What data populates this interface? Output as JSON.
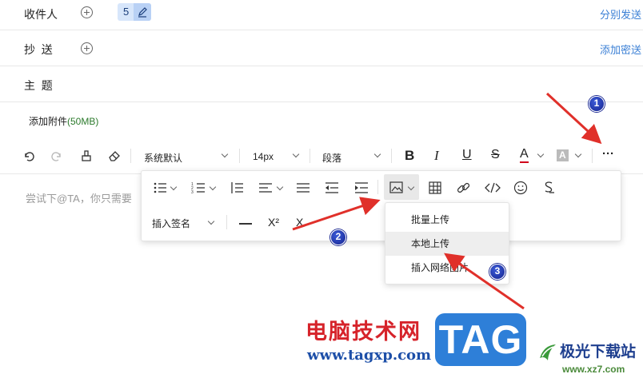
{
  "recipients": {
    "to_label": "收件人",
    "to_count": "5",
    "to_right_link": "分别发送",
    "cc_label": "抄  送",
    "cc_right_link": "添加密送",
    "subject_label": "主  题"
  },
  "attachment": {
    "label": "添加附件",
    "limit": "(50MB)"
  },
  "toolbar": {
    "font_family": "系统默认",
    "font_size": "14px",
    "paragraph": "段落",
    "bold": "B",
    "italic": "I",
    "underline": "U",
    "strike": "S",
    "font_color": "A",
    "bg_color": "A",
    "more": "···"
  },
  "editor": {
    "placeholder": "尝试下@TA，你只需要"
  },
  "popup": {
    "signature": "插入签名",
    "superscript": "X²",
    "subscript": "X"
  },
  "image_menu": {
    "items": [
      "批量上传",
      "本地上传",
      "插入网络图片"
    ]
  },
  "annotations": {
    "badge1": "1",
    "badge2": "2",
    "badge3": "3"
  },
  "watermark": {
    "site_cn": "电脑技术网",
    "site_url": "www.tagxp.com",
    "tag_logo": "TAG",
    "jg_name": "极光下载站",
    "jg_url": "www.xz7.com"
  },
  "colors": {
    "accent": "#3a7fd5",
    "annotation_arrow": "#e0302a",
    "badge": "#1a2b9c"
  }
}
